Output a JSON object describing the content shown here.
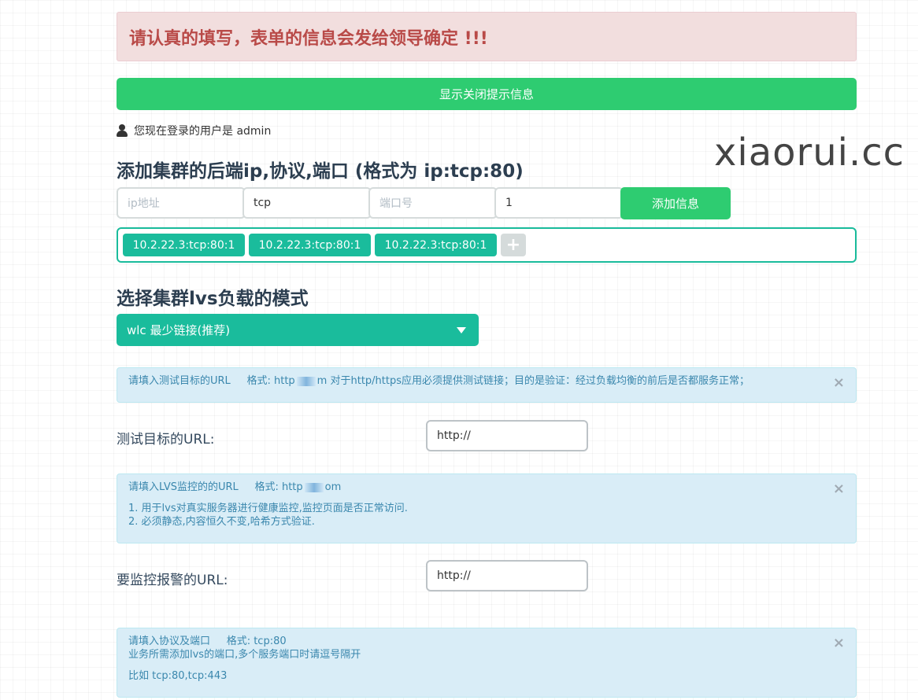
{
  "warning_banner": "请认真的填写，表单的信息会发给领导确定 !!!",
  "toggle_button": "显示关闭提示信息",
  "user_line": "您现在登录的用户是 admin",
  "watermark": "xiaorui.cc",
  "backend_section": {
    "heading": "添加集群的后端ip,协议,端口 (格式为 ip:tcp:80)",
    "ip_placeholder": "ip地址",
    "protocol_value": "tcp",
    "port_placeholder": "端口号",
    "weight_value": "1",
    "add_button": "添加信息",
    "tags": [
      "10.2.22.3:tcp:80:1",
      "10.2.22.3:tcp:80:1",
      "10.2.22.3:tcp:80:1"
    ],
    "add_tag_symbol": "+"
  },
  "mode_section": {
    "heading": "选择集群lvs负载的模式",
    "selected": "wlc 最少链接(推荐)"
  },
  "info_test_url": {
    "prefix": "请填入测试目标的URL",
    "format_label": "格式: http",
    "format_suffix": "m",
    "desc": "对于http/https应用必须提供测试链接；目的是验证：经过负载均衡的前后是否都服务正常；",
    "close": "×"
  },
  "test_url": {
    "label": "测试目标的URL:",
    "value": "http://"
  },
  "info_monitor_url": {
    "prefix": "请填入LVS监控的的URL",
    "format_label": "格式: http",
    "format_suffix": "om",
    "line1": "1. 用于lvs对真实服务器进行健康监控,监控页面是否正常访问.",
    "line2": "2. 必须静态,内容恒久不变,哈希方式验证.",
    "close": "×"
  },
  "monitor_url": {
    "label": "要监控报警的URL:",
    "value": "http://"
  },
  "info_ports": {
    "line1_prefix": "请填入协议及端口",
    "line1_format": "格式: tcp:80",
    "line2": "业务所需添加lvs的端口,多个服务端口时请逗号隔开",
    "line3": "比如 tcp:80,tcp:443",
    "close": "×"
  },
  "colors": {
    "primary_green": "#2ecc71",
    "teal": "#1abc9c",
    "danger_bg": "#f2dede",
    "danger_text": "#b94a48",
    "info_bg": "#d9edf7",
    "info_text": "#3a87ad"
  }
}
